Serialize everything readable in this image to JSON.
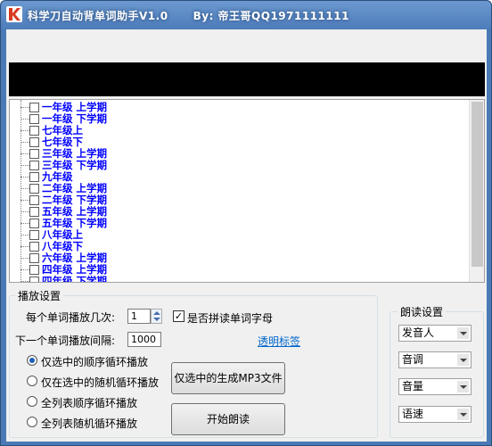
{
  "window": {
    "title": "科学刀自动背单词助手V1.0      By: 帝王哥QQ1971111111"
  },
  "word_list": {
    "items": [
      "一年级 上学期",
      "一年级 下学期",
      "七年级上",
      "七年级下",
      "三年级 上学期",
      "三年级 下学期",
      "九年级",
      "二年级 上学期",
      "二年级 下学期",
      "五年级 上学期",
      "五年级 下学期",
      "八年级上",
      "八年级下",
      "六年级 上学期",
      "四年级 上学期",
      "四年级 下学期"
    ]
  },
  "playback": {
    "group_title": "播放设置",
    "repeat_label": "每个单词播放几次:",
    "repeat_value": "1",
    "spell_label": "是否拼读单词字母",
    "spell_checked": true,
    "interval_label": "下一个单词播放间隔:",
    "interval_value": "1000",
    "transparent_link": "透明标签",
    "radios": [
      {
        "label": "仅选中的顺序循环播放",
        "selected": true
      },
      {
        "label": "仅在选中的随机循环播放",
        "selected": false
      },
      {
        "label": "全列表顺序循环播放",
        "selected": false
      },
      {
        "label": "全列表随机循环播放",
        "selected": false
      }
    ],
    "generate_mp3_button": "仅选中的生成MP3文件",
    "start_button": "开始朗读"
  },
  "reading": {
    "group_title": "朗读设置",
    "voice": "发音人",
    "tone": "音调",
    "volume": "音量",
    "speed": "语速"
  },
  "colors": {
    "title_bar": "#4d7cbb",
    "tree_text": "#0000ff",
    "link": "#0066cc"
  }
}
